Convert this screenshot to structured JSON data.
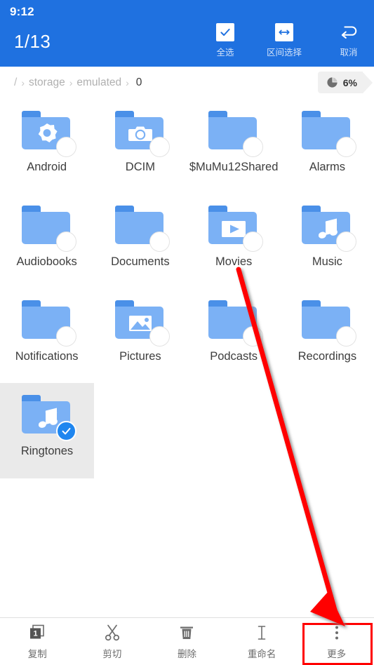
{
  "status_bar": {
    "time": "9:12"
  },
  "header": {
    "selection_count": "1/13",
    "actions": [
      {
        "label": "全选",
        "icon": "check-icon"
      },
      {
        "label": "区间选择",
        "icon": "range-select-icon"
      },
      {
        "label": "取消",
        "icon": "undo-icon"
      }
    ]
  },
  "breadcrumb": {
    "root": "/",
    "items": [
      "storage",
      "emulated"
    ],
    "current": "0",
    "separator": "›"
  },
  "storage_badge": {
    "percent": "6%",
    "icon": "pie-chart-icon"
  },
  "files": [
    {
      "name": "Android",
      "icon": "folder-settings-icon",
      "selected": false
    },
    {
      "name": "DCIM",
      "icon": "folder-camera-icon",
      "selected": false
    },
    {
      "name": "$MuMu12Shared",
      "icon": "folder-icon",
      "selected": false
    },
    {
      "name": "Alarms",
      "icon": "folder-icon",
      "selected": false
    },
    {
      "name": "Audiobooks",
      "icon": "folder-icon",
      "selected": false
    },
    {
      "name": "Documents",
      "icon": "folder-icon",
      "selected": false
    },
    {
      "name": "Movies",
      "icon": "folder-video-icon",
      "selected": false
    },
    {
      "name": "Music",
      "icon": "folder-music-icon",
      "selected": false
    },
    {
      "name": "Notifications",
      "icon": "folder-icon",
      "selected": false
    },
    {
      "name": "Pictures",
      "icon": "folder-image-icon",
      "selected": false
    },
    {
      "name": "Podcasts",
      "icon": "folder-icon",
      "selected": false
    },
    {
      "name": "Recordings",
      "icon": "folder-icon",
      "selected": false
    },
    {
      "name": "Ringtones",
      "icon": "folder-music-icon",
      "selected": true
    }
  ],
  "toolbar": {
    "items": [
      {
        "label": "复制",
        "icon": "copy-icon",
        "highlighted": false
      },
      {
        "label": "剪切",
        "icon": "cut-icon",
        "highlighted": false
      },
      {
        "label": "删除",
        "icon": "delete-icon",
        "highlighted": false
      },
      {
        "label": "重命名",
        "icon": "rename-icon",
        "highlighted": false
      },
      {
        "label": "更多",
        "icon": "more-icon",
        "highlighted": true
      }
    ]
  },
  "colors": {
    "header_blue": "#1f71e0",
    "folder_blue": "#7bb1f5",
    "folder_tab_blue": "#4a90e8",
    "accent_check": "#1f86ef",
    "annotation_red": "#ff0000",
    "selection_bg": "#eaeaea"
  }
}
